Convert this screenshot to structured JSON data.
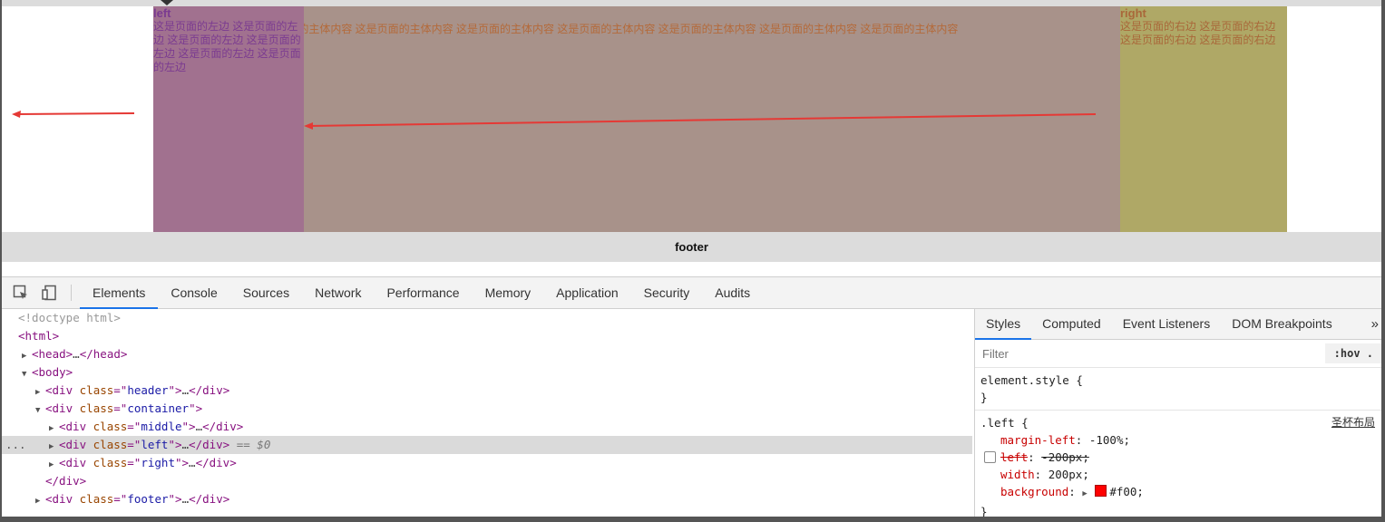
{
  "page": {
    "left": {
      "title": "left",
      "text": "这是页面的左边 这是页面的左边 这是页面的左边 这是页面的左边 这是页面的左边 这是页面的左边"
    },
    "middle": {
      "text": "这是页面的主体内容 这是页面的主体内容 这是页面的主体内容 这是页面的主体内容 这是页面的主体内容 这是页面的主体内容 这是页面的主体内容 这是页面的主体内容"
    },
    "right": {
      "title": "right",
      "text": "这是页面的右边 这是页面的右边 这是页面的右边 这是页面的右边"
    },
    "footer": "footer"
  },
  "devtools": {
    "tabs": [
      "Elements",
      "Console",
      "Sources",
      "Network",
      "Performance",
      "Memory",
      "Application",
      "Security",
      "Audits"
    ],
    "active_tab": "Elements",
    "dom": {
      "doctype": "<!doctype html>",
      "html_tag": "html",
      "head": {
        "tag": "head",
        "ellipsis": "…"
      },
      "body_tag": "body",
      "header": {
        "tag": "div",
        "attr": "class",
        "value": "header"
      },
      "container": {
        "tag": "div",
        "attr": "class",
        "value": "container"
      },
      "middle": {
        "tag": "div",
        "attr": "class",
        "value": "middle"
      },
      "left": {
        "tag": "div",
        "attr": "class",
        "value": "left",
        "marker": "== $0"
      },
      "right": {
        "tag": "div",
        "attr": "class",
        "value": "right"
      },
      "close_div": "</div>",
      "footer": {
        "tag": "div",
        "attr": "class",
        "value": "footer"
      },
      "gutter_dots": "..."
    },
    "styles": {
      "tabs": [
        "Styles",
        "Computed",
        "Event Listeners",
        "DOM Breakpoints"
      ],
      "more": "»",
      "filter_placeholder": "Filter",
      "hov": ":hov .",
      "element_style": "element.style {",
      "close_brace": "}",
      "rule_selector": ".left {",
      "rule_source": "圣杯布局",
      "declarations": [
        {
          "prop": "margin-left",
          "value": "-100%;",
          "disabled": false
        },
        {
          "prop": "left",
          "value": "-200px;",
          "disabled": true
        },
        {
          "prop": "width",
          "value": "200px;",
          "disabled": false
        },
        {
          "prop": "background",
          "value": "#f00;",
          "disabled": false,
          "swatch": "#ff0000"
        }
      ]
    }
  }
}
